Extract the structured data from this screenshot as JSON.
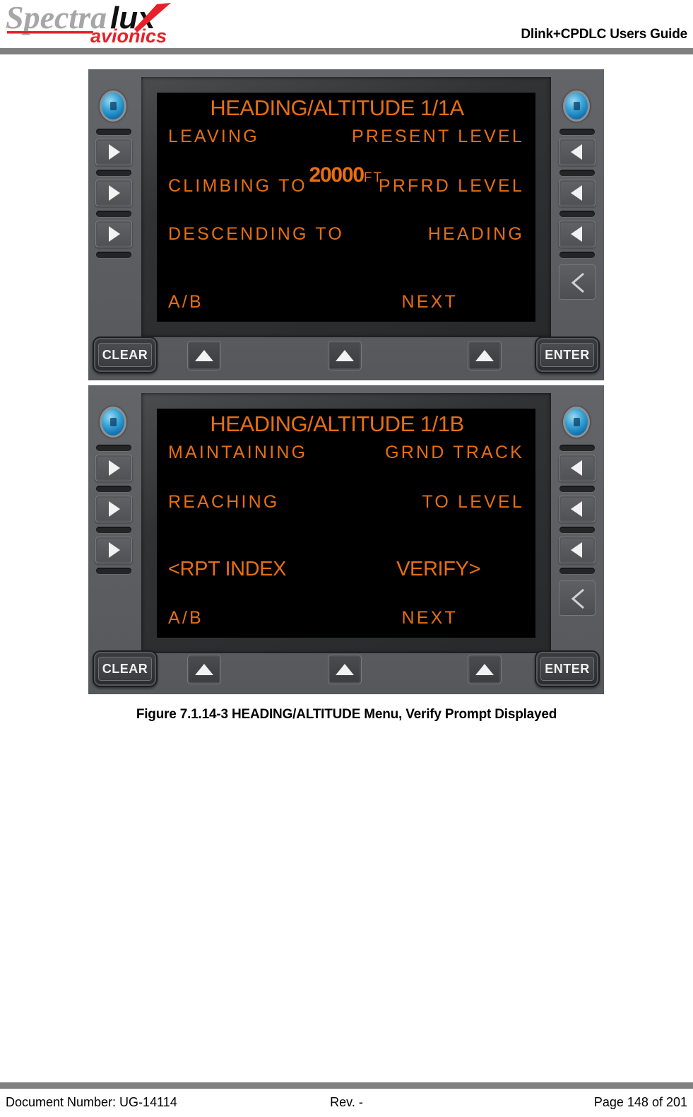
{
  "header": {
    "logo_main": "Spectra",
    "logo_bold": "lux",
    "logo_sub": "avionics",
    "title": "Dlink+CPDLC Users Guide"
  },
  "colors": {
    "lcd_amber": "#e66f11",
    "bezel_gray": "#5d5f62",
    "rule_gray": "#808080",
    "logo_gray": "#a6a6a6",
    "logo_red": "#e8202a"
  },
  "cdu_common": {
    "knob_name": "brightness-knob",
    "bottom_keys": {
      "clear": "CLEAR",
      "enter": "ENTER",
      "up_arrow": "up-arrow"
    },
    "side_keys": {
      "left": [
        "line-select-left-1",
        "line-select-left-2",
        "line-select-left-3"
      ],
      "right": [
        "line-select-right-1",
        "line-select-right-2",
        "line-select-right-3"
      ],
      "back": "back-key"
    }
  },
  "cdu_screens": [
    {
      "id": "cdu-1",
      "title": "HEADING/ALTITUDE 1/1A",
      "rows": [
        {
          "type": "split",
          "style": "spaced",
          "left": "LEAVING",
          "right": "PRESENT LEVEL"
        },
        {
          "type": "altitude",
          "style": "altitude",
          "value": "20000",
          "unit": "FT"
        },
        {
          "type": "split",
          "style": "spaced",
          "left": "CLIMBING TO",
          "right": "PRFRD LEVEL"
        },
        {
          "type": "split",
          "style": "spaced",
          "left": "DESCENDING TO",
          "right": "HEADING"
        },
        {
          "type": "split",
          "style": "spaced",
          "left": "A/B",
          "right": "NEXT"
        }
      ]
    },
    {
      "id": "cdu-2",
      "title": "HEADING/ALTITUDE 1/1B",
      "rows": [
        {
          "type": "split",
          "style": "spaced",
          "left": "MAINTAINING",
          "right": "GRND TRACK"
        },
        {
          "type": "split",
          "style": "spaced",
          "left": "REACHING",
          "right": "TO LEVEL"
        },
        {
          "type": "split",
          "style": "condensed",
          "left": "<RPT INDEX",
          "right": "VERIFY>"
        },
        {
          "type": "split",
          "style": "spaced",
          "left": "A/B",
          "right": "NEXT"
        }
      ]
    }
  ],
  "caption": "Figure 7.1.14-3 HEADING/ALTITUDE Menu, Verify Prompt Displayed",
  "footer": {
    "document_number": "Document Number:  UG-14114",
    "revision": "Rev. -",
    "page": "Page 148 of 201"
  }
}
